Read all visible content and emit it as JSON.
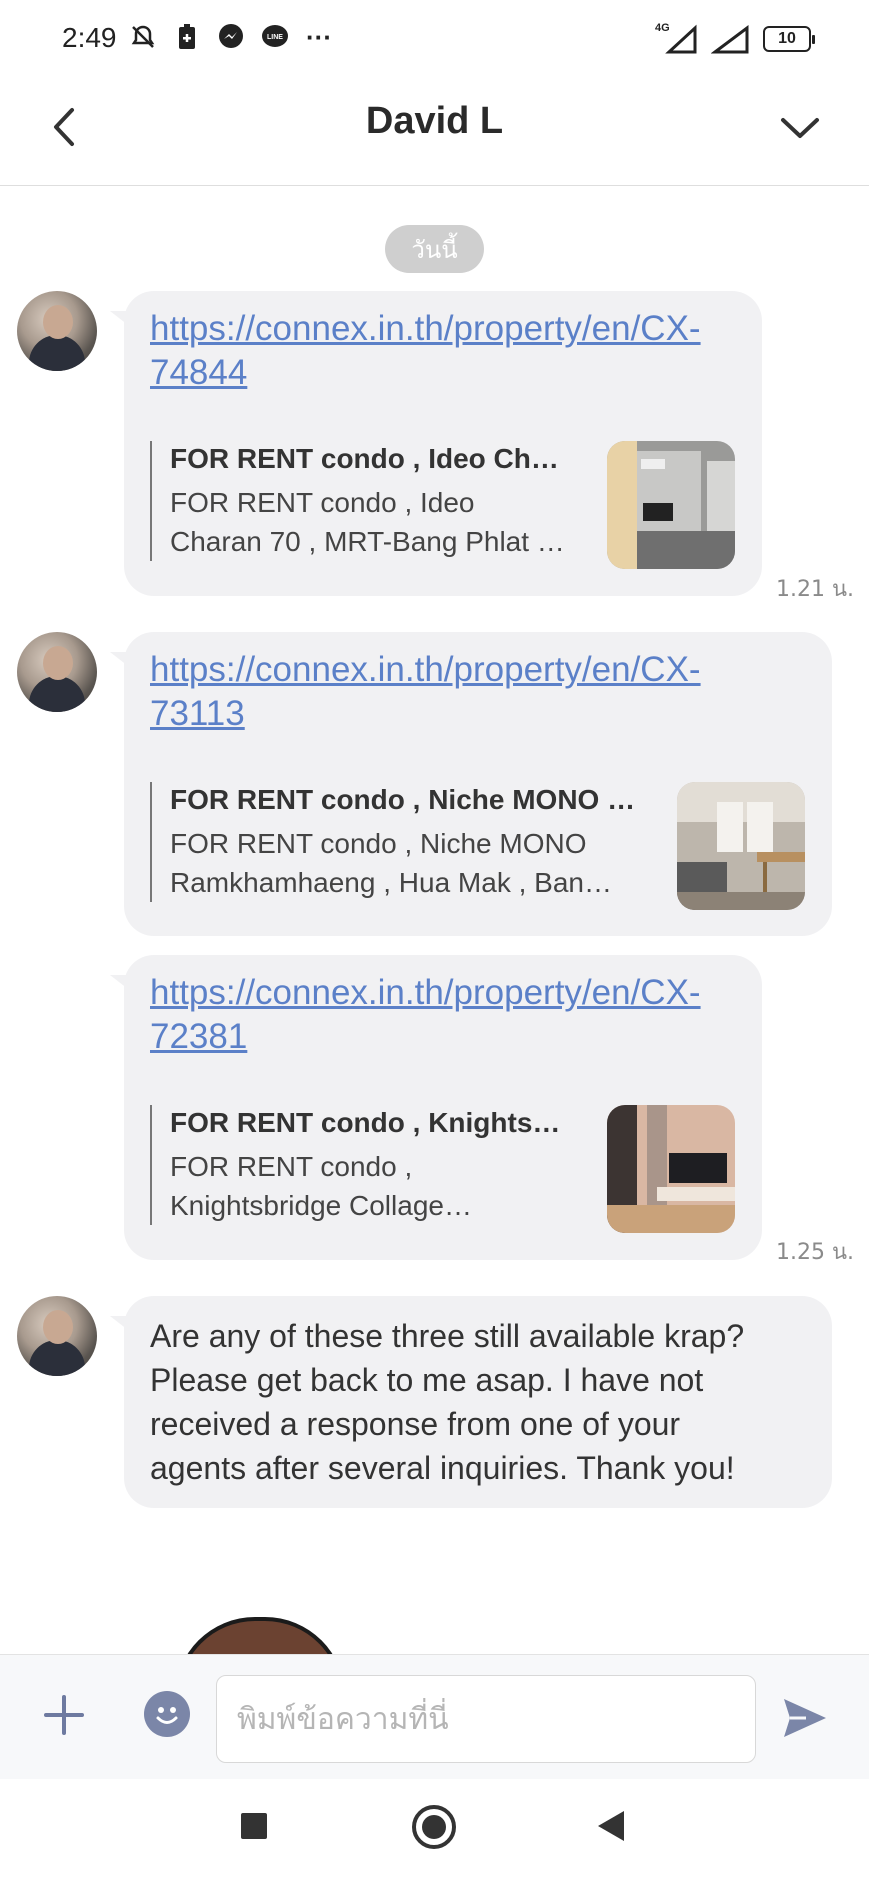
{
  "status_bar": {
    "time": "2:49",
    "network": "4G",
    "battery": "10",
    "more": "···"
  },
  "header": {
    "title": "David L"
  },
  "date_chip": "วันนี้",
  "messages": [
    {
      "link": "https://connex.in.th/property/en/CX-74844",
      "link_line1": "https://connex.in.th/property/en/CX-",
      "link_line2": "74844",
      "preview_title": "FOR RENT condo , Ideo Cha…",
      "preview_desc_line1": "FOR RENT condo , Ideo",
      "preview_desc_line2": "Charan 70 , MRT-Bang Phlat …",
      "time": "1.21 น."
    },
    {
      "link": "https://connex.in.th/property/en/CX-73113",
      "link_line1": "https://connex.in.th/property/en/CX-",
      "link_line2": "73113",
      "preview_title": "FOR RENT condo , Niche MONO …",
      "preview_desc_line1": "FOR RENT condo , Niche MONO",
      "preview_desc_line2": "Ramkhamhaeng , Hua Mak , Ban…"
    },
    {
      "link": "https://connex.in.th/property/en/CX-72381",
      "link_line1": "https://connex.in.th/property/en/CX-",
      "link_line2": "72381",
      "preview_title": "FOR RENT condo , Knightsb…",
      "preview_desc_line1": "FOR RENT condo ,",
      "preview_desc_line2": "Knightsbridge Collage…",
      "time": "1.25 น."
    }
  ],
  "text_message": {
    "line1": "Are any of these three still available krap?",
    "line2": "Please get back to me asap. I have not",
    "line3": "received a response from one of your",
    "line4": "agents after several inquiries. Thank you!"
  },
  "input": {
    "placeholder": "พิมพ์ข้อความที่นี่"
  },
  "colors": {
    "link": "#5b80c8",
    "bubble": "#f1f1f3",
    "accent": "#7b86a8"
  }
}
